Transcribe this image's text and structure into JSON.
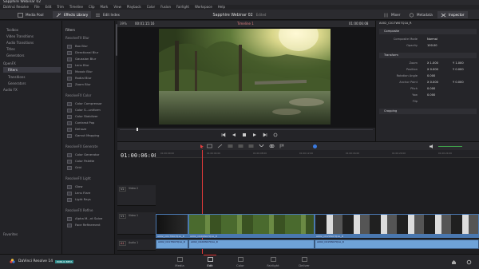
{
  "app": {
    "window_title": "Sapphire Webinar 02",
    "menu": [
      "DaVinci Resolve",
      "File",
      "Edit",
      "Trim",
      "Timeline",
      "Clip",
      "Mark",
      "View",
      "Playback",
      "Color",
      "Fusion",
      "Fairlight",
      "Workspace",
      "Help"
    ],
    "brand": "DaVinci Resolve 14",
    "brand_badge": "PUBLIC BETA"
  },
  "toolbar": {
    "media_pool": "Media Pool",
    "effects_library": "Effects Library",
    "edit_index": "Edit Index",
    "project_title": "Sapphire Webinar 02",
    "project_status": "Edited",
    "mixer": "Mixer",
    "metadata": "Metadata",
    "inspector": "Inspector"
  },
  "effects_tree": {
    "items": [
      {
        "label": "Toolbox",
        "selected": false
      },
      {
        "label": "Video Transitions",
        "selected": false
      },
      {
        "label": "Audio Transitions",
        "selected": false
      },
      {
        "label": "Titles",
        "selected": false
      },
      {
        "label": "Generators",
        "selected": false
      },
      {
        "label": "OpenFX",
        "selected": false
      },
      {
        "label": "Filters",
        "selected": true
      },
      {
        "label": "Transitions",
        "selected": false
      },
      {
        "label": "Generators",
        "selected": false
      },
      {
        "label": "Audio FX",
        "selected": false
      }
    ],
    "favorites": "Favorites"
  },
  "filters_list": {
    "header": "Filters",
    "groups": [
      {
        "name": "ResolveFX Blur",
        "items": [
          "Box Blur",
          "Directional Blur",
          "Gaussian Blur",
          "Lens Blur",
          "Mosaic Blur",
          "Radial Blur",
          "Zoom Blur"
        ]
      },
      {
        "name": "ResolveFX Color",
        "items": [
          "Color Compressor",
          "Color S...uniform",
          "Color Stabilizer",
          "Contrast Pop",
          "Dehaze",
          "Gamut Mapping"
        ]
      },
      {
        "name": "ResolveFX Generate",
        "items": [
          "Color Generator",
          "Color Palette",
          "Grid"
        ]
      },
      {
        "name": "ResolveFX Light",
        "items": [
          "Glow",
          "Lens Flare",
          "Light Rays"
        ]
      },
      {
        "name": "ResolveFX Refine",
        "items": [
          "Alpha M...nt Solve",
          "Face Refinement"
        ]
      }
    ]
  },
  "viewer": {
    "zoom": "39%",
    "timecode_src": "00:01:15:16",
    "clip_name": "Timeline 1",
    "timecode_dst": "01:00:06:08"
  },
  "inspector": {
    "clip": "A002_C017W07Q1A_R",
    "sections": [
      {
        "title": "Composite",
        "rows": [
          [
            "Composite Mode",
            "Normal"
          ],
          [
            "Opacity",
            "100.00"
          ]
        ]
      },
      {
        "title": "Transform",
        "rows": [
          [
            "Zoom",
            "X 1.000",
            "Y 1.000"
          ],
          [
            "Position",
            "X 0.000",
            "Y 0.000"
          ],
          [
            "Rotation Angle",
            "0.000"
          ],
          [
            "Anchor Point",
            "X 0.000",
            "Y 0.000"
          ],
          [
            "Pitch",
            "0.000"
          ],
          [
            "Yaw",
            "0.000"
          ],
          [
            "Flip",
            ""
          ]
        ]
      },
      {
        "title": "Cropping",
        "rows": []
      }
    ]
  },
  "timeline": {
    "timecode": "01:00:06:08",
    "tracks": [
      {
        "id": "V2",
        "name": "Video 2"
      },
      {
        "id": "V1",
        "name": "Video 1"
      },
      {
        "id": "A1",
        "name": "Audio 1"
      }
    ],
    "ruler": [
      "01:00:00:00",
      "01:00:04:00",
      "01:00:08:00",
      "01:00:12:00",
      "01:00:16:00",
      "01:00:20:00",
      "01:00:24:00"
    ],
    "clip_names": [
      "A002_C017W07Q1A_R",
      "A002_C020W07Q1A_R",
      "A002_C015W07Q1A_R"
    ],
    "audio_clip_names": [
      "A002_C017W07Q1A_R",
      "A002_C020W07Q1A_R",
      "A002_C015W07Q1A_R"
    ]
  },
  "pages": [
    {
      "label": "Media",
      "icon": "media-icon",
      "active": false
    },
    {
      "label": "Edit",
      "icon": "edit-icon",
      "active": true
    },
    {
      "label": "Color",
      "icon": "color-icon",
      "active": false
    },
    {
      "label": "Fairlight",
      "icon": "fairlight-icon",
      "active": false
    },
    {
      "label": "Deliver",
      "icon": "deliver-icon",
      "active": false
    }
  ],
  "colors": {
    "accent_red": "#e23a3a",
    "video_clip": "#4a78b0",
    "audio_clip": "#6fa3d8",
    "selected": "#3a3a42"
  }
}
